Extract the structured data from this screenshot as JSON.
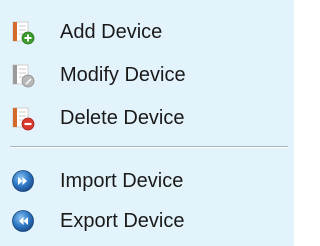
{
  "menu": {
    "items": [
      {
        "label": "Add Device",
        "icon": "add-device-icon",
        "badge_color": "#3c9a2c"
      },
      {
        "label": "Modify Device",
        "icon": "modify-device-icon",
        "badge_color": "#a8a8a8"
      },
      {
        "label": "Delete Device",
        "icon": "delete-device-icon",
        "badge_color": "#d8382e"
      },
      {
        "label": "Import Device",
        "icon": "import-device-icon",
        "badge_color": "#2f79c6"
      },
      {
        "label": "Export Device",
        "icon": "export-device-icon",
        "badge_color": "#2f79c6"
      }
    ]
  },
  "colors": {
    "menu_background": "#e3f3fb",
    "separator": "#a9b6bf",
    "text": "#1a1a1a",
    "spreadsheet_frame": "#d36a2c"
  }
}
